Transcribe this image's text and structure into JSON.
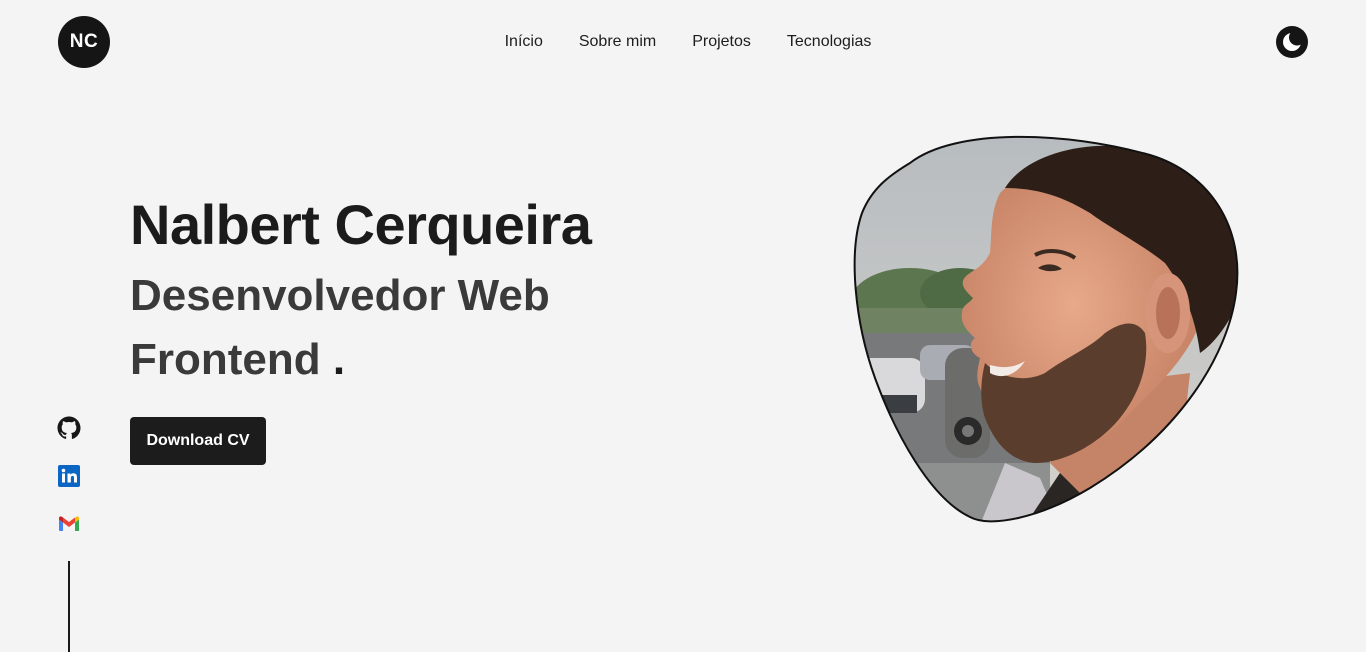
{
  "header": {
    "logo_text": "NC",
    "nav": [
      {
        "label": "Início"
      },
      {
        "label": "Sobre mim"
      },
      {
        "label": "Projetos"
      },
      {
        "label": "Tecnologias"
      }
    ],
    "theme_icon": "moon-icon"
  },
  "hero": {
    "name": "Nalbert Cerqueira",
    "role": "Desenvolvedor Web Frontend",
    "typing_cursor": ".",
    "download_label": "Download CV",
    "photo_icon": "profile-photo"
  },
  "social": [
    {
      "icon": "github-icon"
    },
    {
      "icon": "linkedin-icon"
    },
    {
      "icon": "gmail-icon"
    }
  ],
  "colors": {
    "background": "#f4f4f4",
    "primary": "#1c1c1c",
    "secondary_text": "#3a3a3a",
    "linkedin": "#0a66c2"
  }
}
